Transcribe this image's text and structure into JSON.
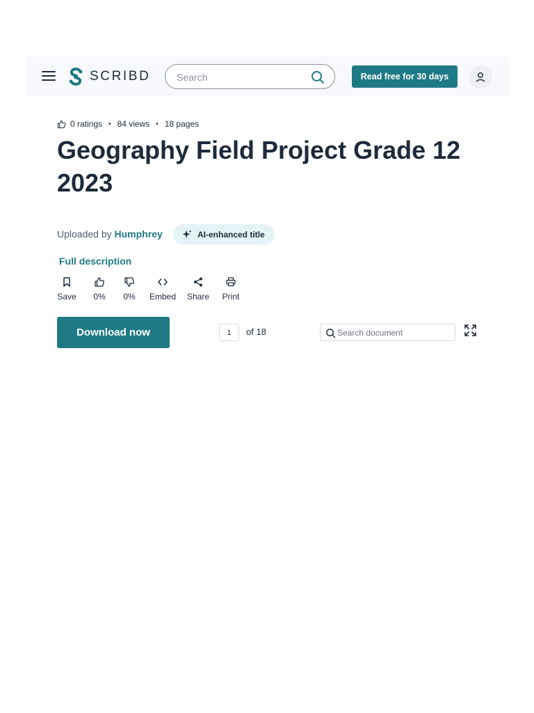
{
  "header": {
    "logo_text": "SCRIBD",
    "search_placeholder": "Search",
    "cta_label": "Read free for 30 days",
    "brand_color": "#1f7a85"
  },
  "meta": {
    "ratings": "0 ratings",
    "views": "84 views",
    "pages": "18 pages",
    "separator": "•"
  },
  "document": {
    "title": "Geography Field Project Grade 12 2023",
    "uploaded_prefix": "Uploaded by",
    "author": "Humphrey",
    "ai_badge": "AI-enhanced title",
    "full_description": "Full description"
  },
  "actions": [
    {
      "label": "Save",
      "icon": "bookmark-icon"
    },
    {
      "label": "0%",
      "icon": "thumbs-up-icon"
    },
    {
      "label": "0%",
      "icon": "thumbs-down-icon"
    },
    {
      "label": "Embed",
      "icon": "code-icon"
    },
    {
      "label": "Share",
      "icon": "share-icon"
    },
    {
      "label": "Print",
      "icon": "print-icon"
    }
  ],
  "viewer": {
    "download_label": "Download now",
    "current_page": "1",
    "page_total_label": "of 18",
    "search_placeholder": "Search document"
  }
}
